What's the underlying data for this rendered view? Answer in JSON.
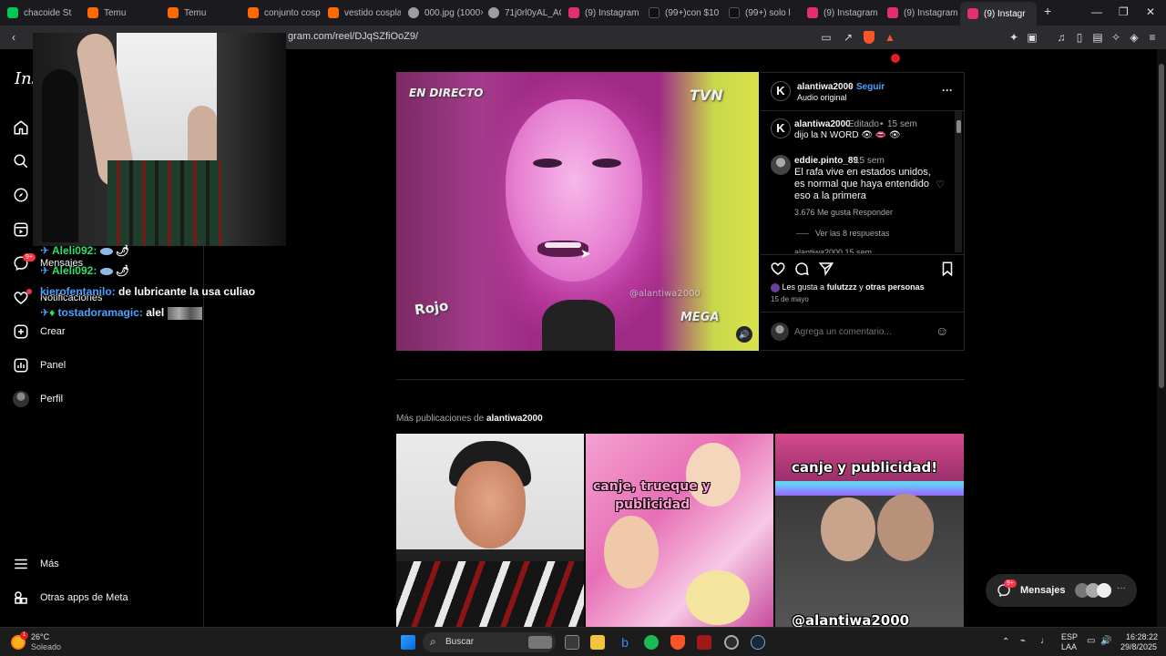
{
  "tabs": [
    {
      "label": "chacoide St",
      "color": "#00c853"
    },
    {
      "label": "Temu",
      "color": "#ff6a00"
    },
    {
      "label": "Temu",
      "color": "#ff6a00"
    },
    {
      "label": "conjunto cospl",
      "color": "#ff6a00"
    },
    {
      "label": "vestido cospla",
      "color": "#ff6a00"
    },
    {
      "label": "000.jpg (1000×",
      "color": "#9e9e9e"
    },
    {
      "label": "71j0rl0yAL_AC",
      "color": "#9e9e9e"
    },
    {
      "label": "(9) Instagram",
      "color": "#e1306c"
    },
    {
      "label": "(99+)con $10 c",
      "color": "#111111"
    },
    {
      "label": "(99+) solo l",
      "color": "#111111"
    },
    {
      "label": "(9) Instagram",
      "color": "#e1306c"
    },
    {
      "label": "(9) Instagram",
      "color": "#e1306c"
    },
    {
      "label": "(9) Instagr",
      "color": "#e1306c"
    }
  ],
  "address_bar": {
    "url": "gram.com/reel/DJqSZfiOoZ9/"
  },
  "sidebar": {
    "logo": "Ins",
    "items": [
      {
        "label": "",
        "icon": "home-icon"
      },
      {
        "label": "",
        "icon": "search-icon"
      },
      {
        "label": "",
        "icon": "explore-icon"
      },
      {
        "label": "",
        "icon": "reels-icon"
      },
      {
        "label": "Mensajes",
        "icon": "messenger-icon"
      },
      {
        "label": "Notificaciones",
        "icon": "heart-icon"
      },
      {
        "label": "Crear",
        "icon": "plus-square-icon"
      },
      {
        "label": "Panel",
        "icon": "chart-icon"
      },
      {
        "label": "Perfil",
        "icon": "avatar"
      },
      {
        "label": "Más",
        "icon": "menu-icon"
      },
      {
        "label": "Otras apps de Meta",
        "icon": "meta-apps-icon"
      }
    ],
    "messages_badge": "9+"
  },
  "chat": [
    {
      "user": "Aleli092:",
      "message": "",
      "user_color": "#2ee06a"
    },
    {
      "user": "Aleli092:",
      "message": "",
      "user_color": "#2ee06a"
    },
    {
      "user": "kierofentanilo:",
      "message": "de lubricante la usa culiao",
      "user_color": "#4aa3ff"
    },
    {
      "user": "tostadoramagic:",
      "message": "alel",
      "user_color": "#4aa3ff"
    }
  ],
  "reel": {
    "watermark_top_left": "EN DIRECTO",
    "watermark_top_right": "TVN",
    "watermark_bottom_left": "Rojo",
    "watermark_bottom_right": "MEGA",
    "watermark_center": "@alantiwa2000"
  },
  "post": {
    "author": "alantiwa2000",
    "follow": "Seguir",
    "audio": "Audio original",
    "caption_author": "alantiwa2000",
    "caption_edited": "Editado",
    "caption_time": "15 sem",
    "caption": "dijo la N WORD 👁 👄 👁",
    "comment": {
      "author": "eddie.pinto_89",
      "time": "15 sem",
      "text_lines": [
        "El rafa vive en estados unidos,",
        "es normal que haya entendido",
        "eso a la primera"
      ],
      "likes": "3.676 Me gusta",
      "reply": "Responder",
      "view_replies": "Ver las 8 respuestas"
    },
    "next_comment_partial": "alantiwa2000 15 sem",
    "likes_prefix": "Les gusta a",
    "likes_user": "fulutzzz",
    "likes_and": "y",
    "likes_others": "otras personas",
    "date": "15 de mayo",
    "comment_placeholder": "Agrega un comentario..."
  },
  "more_posts": {
    "prefix": "Más publicaciones de",
    "author": "alantiwa2000",
    "thumb2_caption_l1": "canje, trueque y",
    "thumb2_caption_l2": "publicidad",
    "thumb3_caption": "canje y publicidad!",
    "thumb3_bottom": "@alantiwa2000"
  },
  "messages_pill": {
    "label": "Mensajes",
    "badge": "9+"
  },
  "taskbar": {
    "weather_temp": "26°C",
    "weather_desc": "Soleado",
    "search": "Buscar",
    "lang1": "ESP",
    "lang2": "LAA",
    "time": "16:28:22",
    "date": "29/8/2025",
    "weather_badge": "1"
  }
}
